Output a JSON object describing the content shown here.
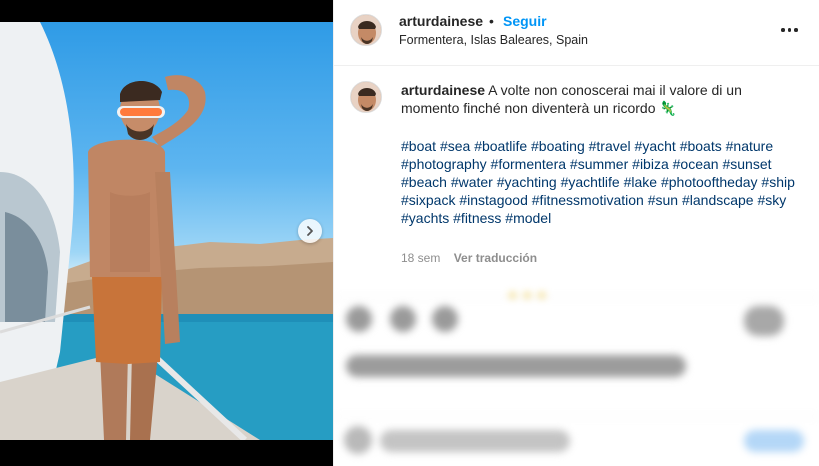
{
  "post": {
    "username": "arturdainese",
    "separator": "•",
    "follow_label": "Seguir",
    "location": "Formentera, Islas Baleares, Spain",
    "caption_user": "arturdainese",
    "caption_text": "A volte non conoscerai mai il valore di un momento finché non diventerà un ricordo",
    "caption_emoji": "🦎",
    "hashtags": [
      "#boat",
      "#sea",
      "#boatlife",
      "#boating",
      "#travel",
      "#yacht",
      "#boats",
      "#nature",
      "#photography",
      "#formentera",
      "#summer",
      "#ibiza",
      "#ocean",
      "#sunset",
      "#beach",
      "#water",
      "#yachting",
      "#yachtlife",
      "#lake",
      "#photooftheday",
      "#ship",
      "#sixpack",
      "#instagood",
      "#fitnessmotivation",
      "#sun",
      "#landscape",
      "#sky",
      "#yachts",
      "#fitness",
      "#model"
    ],
    "timestamp": "18 sem",
    "translate_label": "Ver traducción"
  },
  "icons": {
    "more": "more-options-icon",
    "next": "chevron-right-icon"
  },
  "colors": {
    "link_blue": "#0095f6",
    "hashtag": "#00376b",
    "meta_gray": "#8e8e8e"
  }
}
